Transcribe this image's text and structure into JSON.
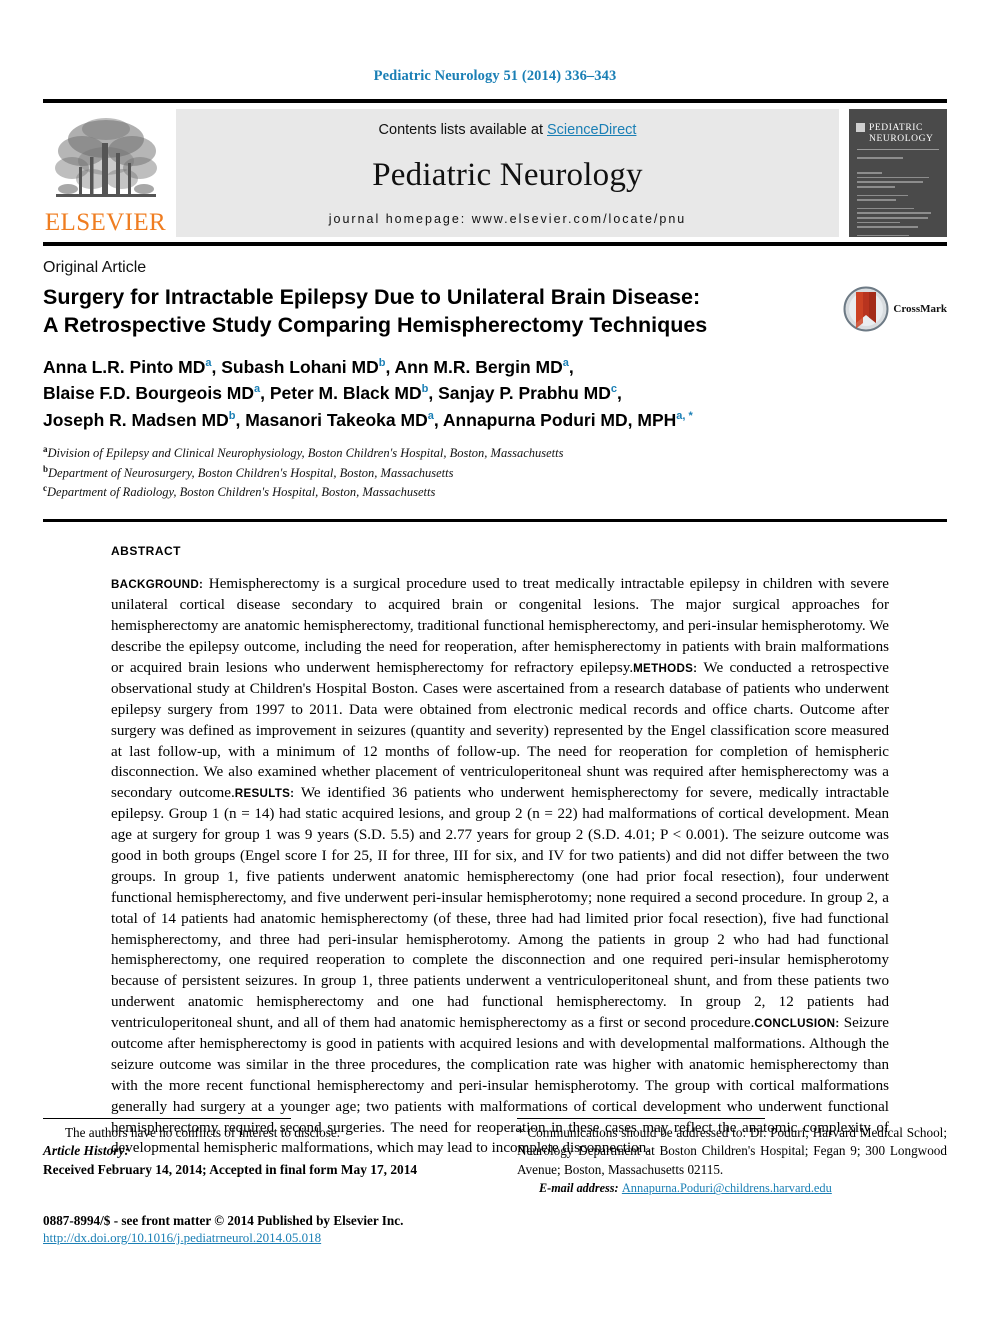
{
  "running_head": "Pediatric Neurology 51 (2014) 336–343",
  "masthead": {
    "contents_prefix": "Contents lists available at ",
    "sciencedirect": "ScienceDirect",
    "journal_name": "Pediatric Neurology",
    "homepage": "journal homepage: www.elsevier.com/locate/pnu",
    "publisher_name": "ELSEVIER",
    "cover_title_line1": "PEDIATRIC",
    "cover_title_line2": "NEUROLOGY",
    "link_color": "#1a7fb5",
    "band_color": "#e8e8e8",
    "cover_color": "#4a4a4a",
    "elsevier_orange": "#ef7d21"
  },
  "article": {
    "type": "Original Article",
    "title_line1": "Surgery for Intractable Epilepsy Due to Unilateral Brain Disease:",
    "title_line2": "A Retrospective Study Comparing Hemispherectomy Techniques",
    "crossmark_label": "CrossMark"
  },
  "authors": {
    "line1": [
      {
        "name": "Anna L.R. Pinto MD",
        "sup": "a",
        "sep": ", "
      },
      {
        "name": "Subash Lohani MD",
        "sup": "b",
        "sep": ", "
      },
      {
        "name": "Ann M.R. Bergin MD",
        "sup": "a",
        "sep": ","
      }
    ],
    "line2": [
      {
        "name": "Blaise F.D. Bourgeois MD",
        "sup": "a",
        "sep": ", "
      },
      {
        "name": "Peter M. Black MD",
        "sup": "b",
        "sep": ", "
      },
      {
        "name": "Sanjay P. Prabhu MD",
        "sup": "c",
        "sep": ","
      }
    ],
    "line3": [
      {
        "name": "Joseph R. Madsen MD",
        "sup": "b",
        "sep": ", "
      },
      {
        "name": "Masanori Takeoka MD",
        "sup": "a",
        "sep": ", "
      },
      {
        "name": "Annapurna Poduri MD, MPH",
        "sup": "a, *",
        "sep": ""
      }
    ]
  },
  "affiliations": [
    {
      "marker": "a",
      "text": "Division of Epilepsy and Clinical Neurophysiology, Boston Children's Hospital, Boston, Massachusetts"
    },
    {
      "marker": "b",
      "text": "Department of Neurosurgery, Boston Children's Hospital, Boston, Massachusetts"
    },
    {
      "marker": "c",
      "text": "Department of Radiology, Boston Children's Hospital, Boston, Massachusetts"
    }
  ],
  "abstract": {
    "label": "ABSTRACT",
    "sections": [
      {
        "heading": "BACKGROUND:",
        "text": " Hemispherectomy is a surgical procedure used to treat medically intractable epilepsy in children with severe unilateral cortical disease secondary to acquired brain or congenital lesions. The major surgical approaches for hemispherectomy are anatomic hemispherectomy, traditional functional hemispherectomy, and peri-insular hemispherotomy. We describe the epilepsy outcome, including the need for reoperation, after hemispherectomy in patients with brain malformations or acquired brain lesions who underwent hemispherectomy for refractory epilepsy."
      },
      {
        "heading": "METHODS:",
        "text": " We conducted a retrospective observational study at Children's Hospital Boston. Cases were ascertained from a research database of patients who underwent epilepsy surgery from 1997 to 2011. Data were obtained from electronic medical records and office charts. Outcome after surgery was defined as improvement in seizures (quantity and severity) represented by the Engel classification score measured at last follow-up, with a minimum of 12 months of follow-up. The need for reoperation for completion of hemispheric disconnection. We also examined whether placement of ventriculoperitoneal shunt was required after hemispherectomy was a secondary outcome."
      },
      {
        "heading": "RESULTS:",
        "text": " We identified 36 patients who underwent hemispherectomy for severe, medically intractable epilepsy. Group 1 (n = 14) had static acquired lesions, and group 2 (n = 22) had malformations of cortical development. Mean age at surgery for group 1 was 9 years (S.D. 5.5) and 2.77 years for group 2 (S.D. 4.01; P < 0.001). The seizure outcome was good in both groups (Engel score I for 25, II for three, III for six, and IV for two patients) and did not differ between the two groups. In group 1, five patients underwent anatomic hemispherectomy (one had prior focal resection), four underwent functional hemispherectomy, and five underwent peri-insular hemispherotomy; none required a second procedure. In group 2, a total of 14 patients had anatomic hemispherectomy (of these, three had had limited prior focal resection), five had functional hemispherectomy, and three had peri-insular hemispherotomy. Among the patients in group 2 who had had functional hemispherectomy, one required reoperation to complete the disconnection and one required peri-insular hemispherotomy because of persistent seizures. In group 1, three patients underwent a ventriculoperitoneal shunt, and from these patients two underwent anatomic hemispherectomy and one had functional hemispherectomy. In group 2, 12 patients had ventriculoperitoneal shunt, and all of them had anatomic hemispherectomy as a first or second procedure."
      },
      {
        "heading": "CONCLUSION:",
        "text": " Seizure outcome after hemispherectomy is good in patients with acquired lesions and with developmental malformations. Although the seizure outcome was similar in the three procedures, the complication rate was higher with anatomic hemispherectomy than with the more recent functional hemispherectomy and peri-insular hemispherotomy. The group with cortical malformations generally had surgery at a younger age; two patients with malformations of cortical development who underwent functional hemispherectomy required second surgeries. The need for reoperation in these cases may reflect the anatomic complexity of developmental hemispheric malformations, which may lead to incomplete disconnection."
      }
    ]
  },
  "footer": {
    "conflicts": "The authors have no conflicts of interest to disclose.",
    "history_label": "Article History:",
    "history_value": "Received February 14, 2014; Accepted in final form May 17, 2014",
    "correspondence": "* Communications should be addressed to: Dr. Poduri; Harvard Medical School; Neurology Department at Boston Children's Hospital; Fegan 9; 300 Longwood Avenue; Boston, Massachusetts 02115.",
    "email_label": "E-mail address:",
    "email_value": "Annapurna.Poduri@childrens.harvard.edu",
    "issn_line": "0887-8994/$ - see front matter © 2014 Published by Elsevier Inc.",
    "doi_line": "http://dx.doi.org/10.1016/j.pediatrneurol.2014.05.018"
  }
}
